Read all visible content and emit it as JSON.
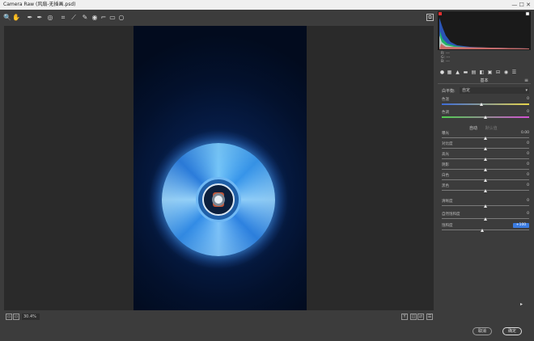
{
  "window": {
    "title": "Camera Raw (风扇-无插画.psd)",
    "controls": "— ☐ ✕"
  },
  "toolbar": {
    "tools": [
      {
        "name": "zoom-tool",
        "glyph": "🔍"
      },
      {
        "name": "hand-tool",
        "glyph": "✋"
      },
      {
        "name": "white-balance-tool",
        "glyph": "✒"
      },
      {
        "name": "color-sampler-tool",
        "glyph": "✒"
      },
      {
        "name": "targeted-adjustment-tool",
        "glyph": "◎"
      },
      {
        "name": "crop-tool",
        "glyph": "⌗"
      },
      {
        "name": "straighten-tool",
        "glyph": "⟋"
      },
      {
        "name": "spot-removal-tool",
        "glyph": "✎"
      },
      {
        "name": "red-eye-tool",
        "glyph": "◉"
      },
      {
        "name": "adjustment-brush-tool",
        "glyph": "⌐"
      },
      {
        "name": "graduated-filter-tool",
        "glyph": "▭"
      },
      {
        "name": "radial-filter-tool",
        "glyph": "○"
      }
    ],
    "prefs_glyph": "⧉"
  },
  "preview": {
    "zoom": "30.4%"
  },
  "histogram": {
    "readouts": [
      "R: ---",
      "G: ---",
      "B: ---"
    ]
  },
  "panel": {
    "tabs": [
      "●",
      "▦",
      "▲",
      "▬",
      "▤",
      "◧",
      "▣",
      "⊟",
      "◉",
      "☰"
    ],
    "title": "基本",
    "menu_glyph": "≡",
    "white_balance": {
      "label": "白平衡:",
      "value": "自定"
    },
    "auto_label": "自动",
    "default_label": "默认值",
    "sliders": [
      {
        "label": "色温",
        "value": "0",
        "pos": 0.45,
        "track": "temp"
      },
      {
        "label": "色调",
        "value": "0",
        "pos": 0.5,
        "track": "tint"
      },
      {
        "label": "曝光",
        "value": "0.00",
        "pos": 0.5
      },
      {
        "label": "对比度",
        "value": "0",
        "pos": 0.5
      },
      {
        "label": "高光",
        "value": "0",
        "pos": 0.5
      },
      {
        "label": "阴影",
        "value": "0",
        "pos": 0.5
      },
      {
        "label": "白色",
        "value": "0",
        "pos": 0.5
      },
      {
        "label": "黑色",
        "value": "0",
        "pos": 0.5
      },
      {
        "label": "清晰度",
        "value": "0",
        "pos": 0.5
      },
      {
        "label": "自然饱和度",
        "value": "0",
        "pos": 0.5
      },
      {
        "label": "饱和度",
        "value": "+100",
        "pos": 0.46,
        "highlight": true
      }
    ]
  },
  "footer": {
    "cancel": "取消",
    "ok": "确定"
  }
}
